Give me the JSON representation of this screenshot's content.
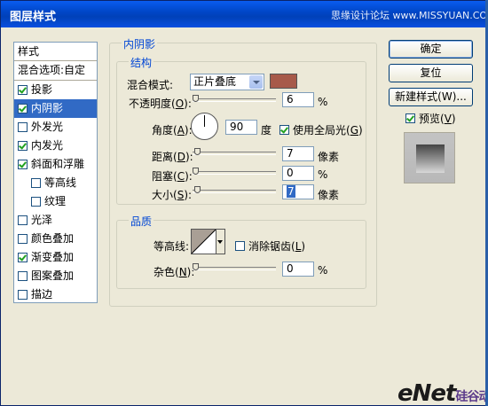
{
  "window": {
    "title": "图层样式",
    "watermark": "思缘设计论坛 www.MISSYUAN.COM"
  },
  "left_panel": {
    "header": "样式",
    "blend_options": "混合选项:自定",
    "items": [
      {
        "label": "投影",
        "checked": true,
        "selected": false,
        "indent": false
      },
      {
        "label": "内阴影",
        "checked": true,
        "selected": true,
        "indent": false
      },
      {
        "label": "外发光",
        "checked": false,
        "selected": false,
        "indent": false
      },
      {
        "label": "内发光",
        "checked": true,
        "selected": false,
        "indent": false
      },
      {
        "label": "斜面和浮雕",
        "checked": true,
        "selected": false,
        "indent": false
      },
      {
        "label": "等高线",
        "checked": false,
        "selected": false,
        "indent": true
      },
      {
        "label": "纹理",
        "checked": false,
        "selected": false,
        "indent": true
      },
      {
        "label": "光泽",
        "checked": false,
        "selected": false,
        "indent": false
      },
      {
        "label": "颜色叠加",
        "checked": false,
        "selected": false,
        "indent": false
      },
      {
        "label": "渐变叠加",
        "checked": true,
        "selected": false,
        "indent": false
      },
      {
        "label": "图案叠加",
        "checked": false,
        "selected": false,
        "indent": false
      },
      {
        "label": "描边",
        "checked": false,
        "selected": false,
        "indent": false
      }
    ]
  },
  "inner_shadow": {
    "section_title": "内阴影",
    "structure": {
      "group_title": "结构",
      "blend_mode_label": "混合模式:",
      "blend_mode_value": "正片叠底",
      "color": "#a75a4a",
      "opacity_label_a": "不透明度(",
      "opacity_key": "O",
      "opacity_label_b": "):",
      "opacity_value": "6",
      "opacity_unit": "%",
      "angle_label_a": "角度(",
      "angle_key": "A",
      "angle_label_b": "):",
      "angle_value": "90",
      "angle_unit": "度",
      "global_light_label_a": "使用全局光(",
      "global_light_key": "G",
      "global_light_label_b": ")",
      "global_light_checked": true,
      "distance_label_a": "距离(",
      "distance_key": "D",
      "distance_label_b": "):",
      "distance_value": "7",
      "distance_unit": "像素",
      "choke_label_a": "阻塞(",
      "choke_key": "C",
      "choke_label_b": "):",
      "choke_value": "0",
      "choke_unit": "%",
      "size_label_a": "大小(",
      "size_key": "S",
      "size_label_b": "):",
      "size_value": "7",
      "size_unit": "像素"
    },
    "quality": {
      "group_title": "品质",
      "contour_label": "等高线:",
      "anti_alias_label_a": "消除锯齿(",
      "anti_alias_key": "L",
      "anti_alias_label_b": ")",
      "anti_alias_checked": false,
      "noise_label_a": "杂色(",
      "noise_key": "N",
      "noise_label_b": "):",
      "noise_value": "0",
      "noise_unit": "%"
    }
  },
  "buttons": {
    "ok": "确定",
    "reset": "复位",
    "new_style": "新建样式(W)...",
    "preview_label_a": "预览(",
    "preview_key": "V",
    "preview_label_b": ")",
    "preview_checked": true
  },
  "logo": {
    "brand": "eNet",
    "sub": "硅谷动力"
  }
}
